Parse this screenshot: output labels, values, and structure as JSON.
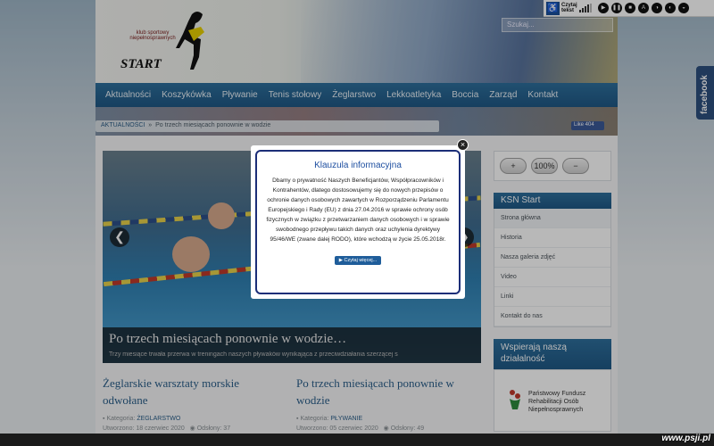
{
  "header": {
    "logo_small_text": "klub sportowy niepełnosprawnych",
    "logo_title": "START",
    "search_placeholder": "Szukaj..."
  },
  "nav": [
    "Aktualności",
    "Koszykówka",
    "Pływanie",
    "Tenis stołowy",
    "Żeglarstwo",
    "Lekkoatletyka",
    "Boccia",
    "Zarząd",
    "Kontakt"
  ],
  "breadcrumb": {
    "home": "Aktualności",
    "separator": "»",
    "current": "Po trzech miesiącach ponownie w wodzie"
  },
  "fb_like": "Like 404",
  "slider": {
    "title": "Po trzech miesiącach ponownie w wodzie…",
    "excerpt": "Trzy miesiące trwała przerwa w treningach naszych pływaków wynikająca z przeciwdziałania szerzącej s"
  },
  "articles": [
    {
      "title": "Żeglarskie warsztaty morskie odwołane",
      "category_label": "Kategoria:",
      "category": "ŻEGLARSTWO",
      "date": "Utworzono: 18 czerwiec 2020",
      "views": "Odsłony: 37"
    },
    {
      "title": "Po trzech miesiącach ponownie w wodzie",
      "category_label": "Kategoria:",
      "category": "PŁYWANIE",
      "date": "Utworzono: 05 czerwiec 2020",
      "views": "Odsłony: 49"
    }
  ],
  "sidebar": {
    "zoom": [
      "+",
      "100%",
      "−"
    ],
    "menu_title": "KSN Start",
    "menu": [
      "Strona główna",
      "Historia",
      "Nasza galeria zdjęć",
      "Video",
      "Linki",
      "Kontakt do nas"
    ],
    "support_title": "Wspierają naszą działalność",
    "pfron": "Państwowy Fundusz Rehabilitacji Osób Niepełnosprawnych"
  },
  "modal": {
    "title": "Klauzula informacyjna",
    "body": "Dbamy o prywatność Naszych Beneficjantów, Współpracowników i Kontrahentów, dlatego dostosowujemy się do nowych przepisów o ochronie danych osobowych zawartych w Rozporządzeniu Parlamentu Europejskiego i Rady (EU) z dnia 27.04.2016 w sprawie ochrony osób fizycznych w związku z przetwarzaniem danych osobowych i w sprawie swobodnego przepływu takich danych oraz uchylenia dyrektywy 95/46/WE (zwane dalej RODO), które wchodzą w życie 25.05.2018r.",
    "button": "Czytaj więcej..."
  },
  "a11y": {
    "read_text": "Czytaj tekst",
    "buttons": [
      "▶",
      "❚❚",
      "■",
      "A",
      "◑",
      "◐",
      "◒"
    ]
  },
  "facebook_tab": "facebook",
  "watermark": "www.psji.pl"
}
